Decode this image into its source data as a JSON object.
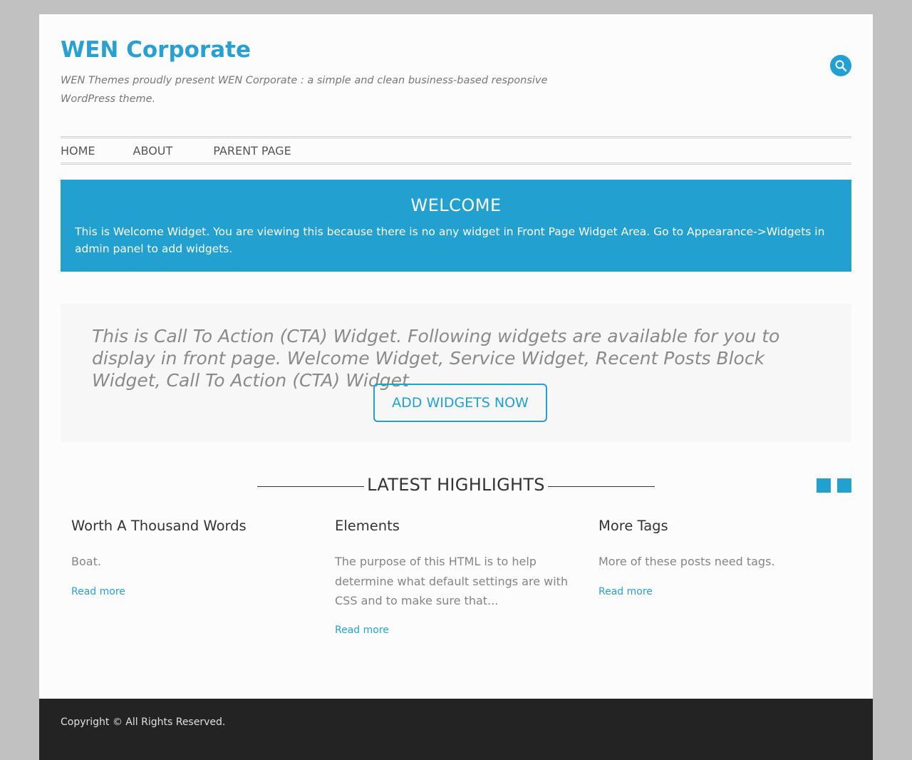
{
  "header": {
    "site_title": "WEN Corporate",
    "tagline": "WEN Themes proudly present WEN Corporate : a simple and clean business-based responsive WordPress theme.",
    "search_icon": "search-icon"
  },
  "nav": {
    "items": [
      {
        "label": "HOME"
      },
      {
        "label": "ABOUT"
      },
      {
        "label": "PARENT PAGE"
      }
    ]
  },
  "welcome": {
    "title": "WELCOME",
    "text": "This is Welcome Widget. You are viewing this because there is no any widget in Front Page Widget Area. Go to Appearance->Widgets in admin panel to add widgets."
  },
  "cta": {
    "text": "This is Call To Action (CTA) Widget. Following widgets are available for you to display in front page. Welcome Widget, Service Widget, Recent Posts Block Widget, Call To Action (CTA) Widget",
    "button_label": "ADD WIDGETS NOW"
  },
  "highlights": {
    "title": "LATEST HIGHLIGHTS",
    "posts": [
      {
        "title": "Worth A Thousand Words",
        "excerpt": "Boat.",
        "read_more": "Read more"
      },
      {
        "title": "Elements",
        "excerpt": "The purpose of this HTML is to help determine what default settings are with CSS and to make sure that...",
        "read_more": "Read more"
      },
      {
        "title": "More Tags",
        "excerpt": "More of these posts need tags.",
        "read_more": "Read more"
      }
    ]
  },
  "footer": {
    "copyright": "Copyright © All Rights Reserved."
  },
  "colors": {
    "accent": "#22a0cf",
    "background": "#c1c1c1",
    "footer": "#232323"
  }
}
